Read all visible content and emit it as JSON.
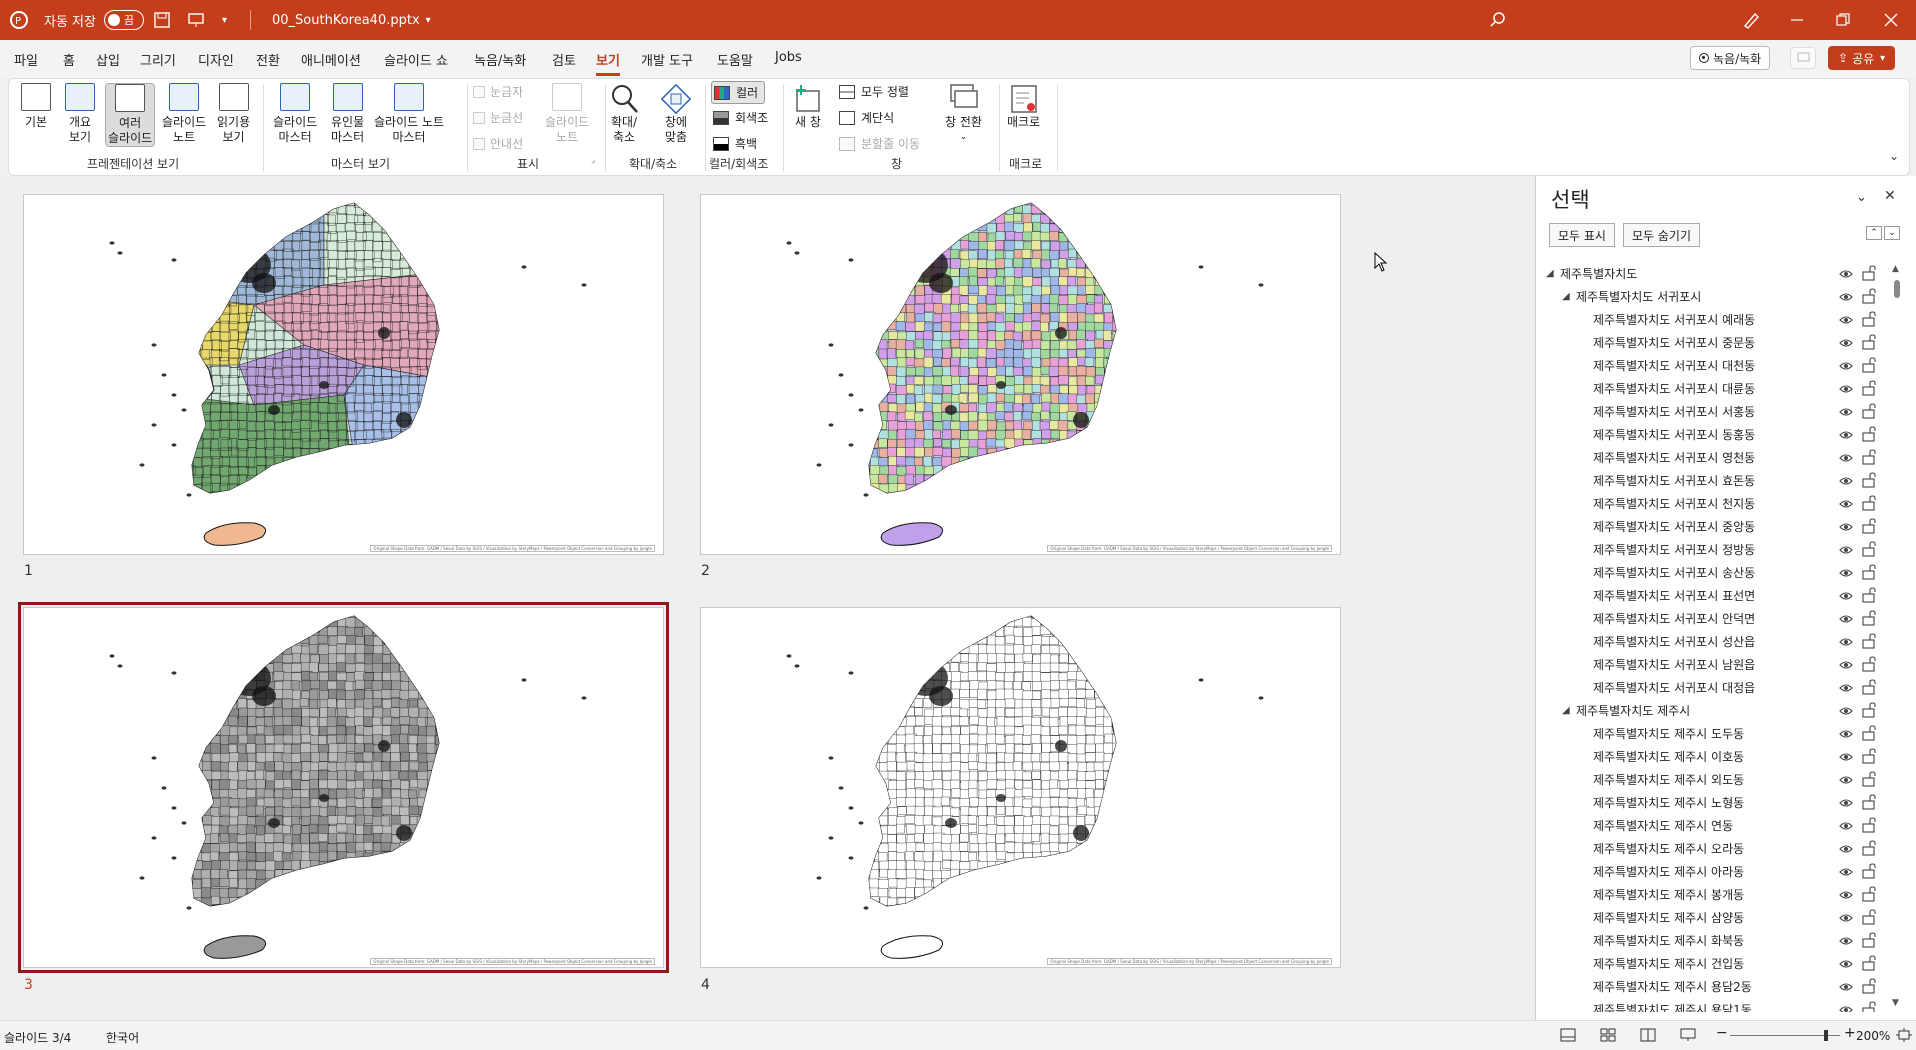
{
  "title_bar": {
    "autosave_label": "자동 저장",
    "autosave_state": "끔",
    "filename": "00_SouthKorea40.pptx",
    "filename_caret": "▾"
  },
  "menu_tabs": [
    "파일",
    "홈",
    "삽입",
    "그리기",
    "디자인",
    "전환",
    "애니메이션",
    "슬라이드 쇼",
    "녹음/녹화",
    "검토",
    "보기",
    "개발 도구",
    "도움말",
    "Jobs"
  ],
  "active_tab": "보기",
  "right_buttons": {
    "record": "녹음/녹화",
    "share": "공유"
  },
  "ribbon": {
    "presentation_views": {
      "label": "프레젠테이션 보기",
      "buttons": [
        {
          "line1": "기본",
          "line2": ""
        },
        {
          "line1": "개요",
          "line2": "보기"
        },
        {
          "line1": "여러",
          "line2": "슬라이드"
        },
        {
          "line1": "슬라이드",
          "line2": "노트"
        },
        {
          "line1": "읽기용",
          "line2": "보기"
        }
      ]
    },
    "master_views": {
      "label": "마스터 보기",
      "buttons": [
        {
          "line1": "슬라이드",
          "line2": "마스터"
        },
        {
          "line1": "유인물",
          "line2": "마스터"
        },
        {
          "line1": "슬라이드 노트",
          "line2": "마스터"
        }
      ]
    },
    "show": {
      "label": "표시",
      "checks": [
        "눈금자",
        "눈금선",
        "안내선"
      ],
      "notes_line1": "슬라이드",
      "notes_line2": "노트"
    },
    "zoom": {
      "label": "확대/축소",
      "zoom_line1": "확대/",
      "zoom_line2": "축소",
      "fit_line1": "창에",
      "fit_line2": "맞춤"
    },
    "color": {
      "label": "컬러/회색조",
      "items": [
        "컬러",
        "회색조",
        "흑백"
      ]
    },
    "window": {
      "label": "창",
      "new_line1": "새 창",
      "arrange_all": "모두 정렬",
      "cascade": "계단식",
      "move_split": "분할줄 이동",
      "switch_line1": "창 전환"
    },
    "macros": {
      "label": "매크로",
      "button": "매크로"
    }
  },
  "slides": [
    {
      "number": "1",
      "style": "regions"
    },
    {
      "number": "2",
      "style": "multicolor"
    },
    {
      "number": "3",
      "style": "grayscale"
    },
    {
      "number": "4",
      "style": "blackwhite"
    }
  ],
  "slide_credit": "Original Shape Data from: GADM / Seoul Data by SGIS / Visualization by StoryMaps / Powerpoint Object Conversion and Grouping by Jungle",
  "selection_pane": {
    "title": "선택",
    "show_all": "모두 표시",
    "hide_all": "모두 숨기기",
    "tree": [
      {
        "level": 0,
        "label": "제주특별자치도"
      },
      {
        "level": 1,
        "label": "제주특별자치도 서귀포시"
      },
      {
        "level": 2,
        "label": "제주특별자치도 서귀포시 예래동"
      },
      {
        "level": 2,
        "label": "제주특별자치도 서귀포시 중문동"
      },
      {
        "level": 2,
        "label": "제주특별자치도 서귀포시 대천동"
      },
      {
        "level": 2,
        "label": "제주특별자치도 서귀포시 대륜동"
      },
      {
        "level": 2,
        "label": "제주특별자치도 서귀포시 서홍동"
      },
      {
        "level": 2,
        "label": "제주특별자치도 서귀포시 동홍동"
      },
      {
        "level": 2,
        "label": "제주특별자치도 서귀포시 영천동"
      },
      {
        "level": 2,
        "label": "제주특별자치도 서귀포시 효돈동"
      },
      {
        "level": 2,
        "label": "제주특별자치도 서귀포시 천지동"
      },
      {
        "level": 2,
        "label": "제주특별자치도 서귀포시 중앙동"
      },
      {
        "level": 2,
        "label": "제주특별자치도 서귀포시 정방동"
      },
      {
        "level": 2,
        "label": "제주특별자치도 서귀포시 송산동"
      },
      {
        "level": 2,
        "label": "제주특별자치도 서귀포시 표선면"
      },
      {
        "level": 2,
        "label": "제주특별자치도 서귀포시 안덕면"
      },
      {
        "level": 2,
        "label": "제주특별자치도 서귀포시 성산읍"
      },
      {
        "level": 2,
        "label": "제주특별자치도 서귀포시 남원읍"
      },
      {
        "level": 2,
        "label": "제주특별자치도 서귀포시 대정읍"
      },
      {
        "level": 1,
        "label": "제주특별자치도 제주시"
      },
      {
        "level": 2,
        "label": "제주특별자치도 제주시 도두동"
      },
      {
        "level": 2,
        "label": "제주특별자치도 제주시 이호동"
      },
      {
        "level": 2,
        "label": "제주특별자치도 제주시 외도동"
      },
      {
        "level": 2,
        "label": "제주특별자치도 제주시 노형동"
      },
      {
        "level": 2,
        "label": "제주특별자치도 제주시 연동"
      },
      {
        "level": 2,
        "label": "제주특별자치도 제주시 오라동"
      },
      {
        "level": 2,
        "label": "제주특별자치도 제주시 아라동"
      },
      {
        "level": 2,
        "label": "제주특별자치도 제주시 봉개동"
      },
      {
        "level": 2,
        "label": "제주특별자치도 제주시 삼양동"
      },
      {
        "level": 2,
        "label": "제주특별자치도 제주시 화북동"
      },
      {
        "level": 2,
        "label": "제주특별자치도 제주시 건입동"
      },
      {
        "level": 2,
        "label": "제주특별자치도 제주시 용담2동"
      },
      {
        "level": 2,
        "label": "제주특별자치도 제주시 용담1동"
      }
    ]
  },
  "status_bar": {
    "slide_info": "슬라이드 3/4",
    "language": "한국어",
    "zoom": "200%"
  },
  "colors": {
    "accent": "#c43e1c",
    "selected_outline": "#8b1a1a"
  }
}
